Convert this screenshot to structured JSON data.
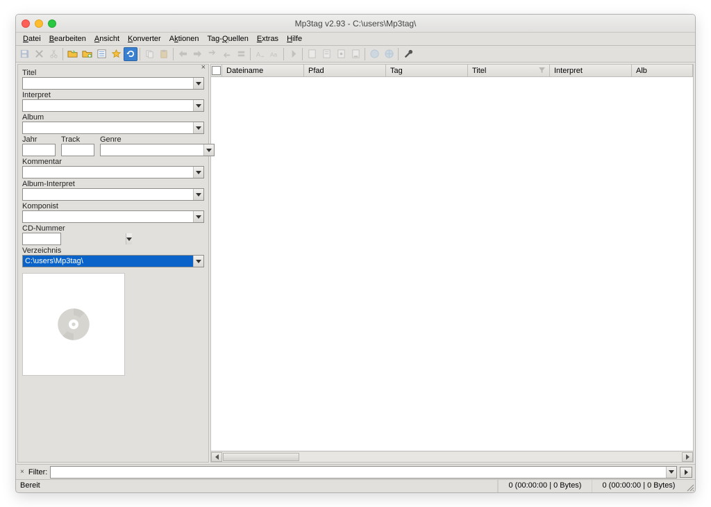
{
  "title": "Mp3tag v2.93  -  C:\\users\\Mp3tag\\",
  "menu": [
    "Datei",
    "Bearbeiten",
    "Ansicht",
    "Konverter",
    "Aktionen",
    "Tag-Quellen",
    "Extras",
    "Hilfe"
  ],
  "sidebar": {
    "titel_label": "Titel",
    "interpret_label": "Interpret",
    "album_label": "Album",
    "jahr_label": "Jahr",
    "track_label": "Track",
    "genre_label": "Genre",
    "kommentar_label": "Kommentar",
    "albuminterpret_label": "Album-Interpret",
    "komponist_label": "Komponist",
    "cdnummer_label": "CD-Nummer",
    "verzeichnis_label": "Verzeichnis",
    "verzeichnis_value": "C:\\users\\Mp3tag\\"
  },
  "columns": [
    "Dateiname",
    "Pfad",
    "Tag",
    "Titel",
    "Interpret",
    "Alb"
  ],
  "filter_label": "Filter:",
  "status": {
    "ready": "Bereit",
    "metric1": "0 (00:00:00 | 0 Bytes)",
    "metric2": "0 (00:00:00 | 0 Bytes)"
  }
}
